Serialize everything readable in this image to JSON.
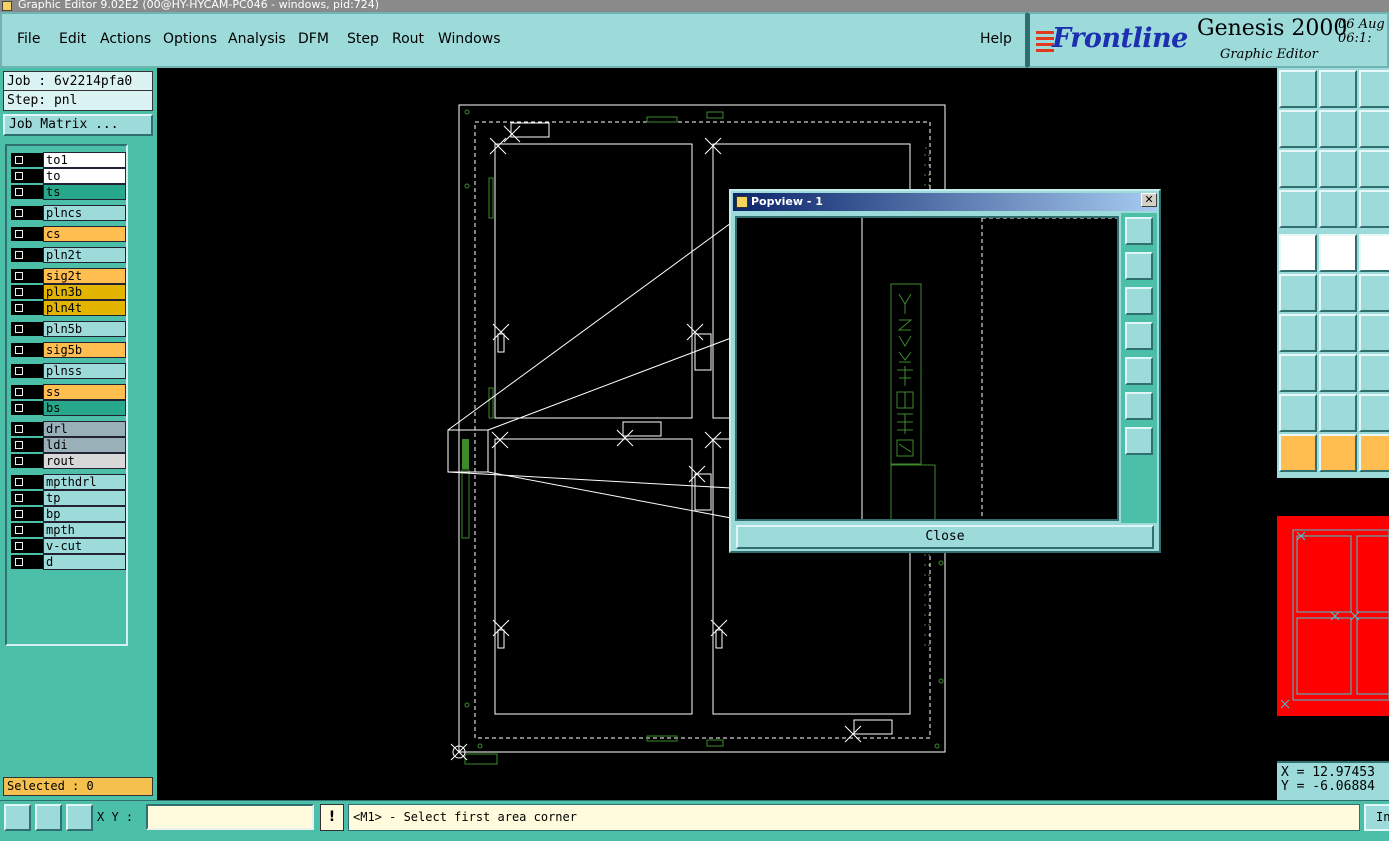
{
  "window": {
    "title": "Graphic Editor 9.02E2 (00@HY-HYCAM-PC046 - windows, pid:724)"
  },
  "menu": {
    "items": [
      {
        "label": "File"
      },
      {
        "label": "Edit"
      },
      {
        "label": "Actions"
      },
      {
        "label": "Options"
      },
      {
        "label": "Analysis"
      },
      {
        "label": "DFM"
      },
      {
        "label": "Step"
      },
      {
        "label": "Rout"
      },
      {
        "label": "Windows"
      }
    ],
    "help": "Help"
  },
  "logo": {
    "brand": "Frontline",
    "product": "Genesis 2000",
    "subtitle": "Graphic Editor",
    "date_line1": "06 Aug",
    "date_line2": "06:1:"
  },
  "job": {
    "job_line": "Job : 6v2214pfa0",
    "step_line": "Step: pnl",
    "matrix_button": "Job Matrix ..."
  },
  "layers": [
    {
      "name": "to1",
      "color": "white"
    },
    {
      "name": "to",
      "color": "white"
    },
    {
      "name": "ts",
      "color": "teal"
    },
    {
      "name": "plncs",
      "color": "cyan"
    },
    {
      "name": "cs",
      "color": "orange"
    },
    {
      "name": "pln2t",
      "color": "cyan"
    },
    {
      "name": "sig2t",
      "color": "orange"
    },
    {
      "name": "pln3b",
      "color": "gold"
    },
    {
      "name": "pln4t",
      "color": "gold"
    },
    {
      "name": "pln5b",
      "color": "cyan"
    },
    {
      "name": "sig5b",
      "color": "orange"
    },
    {
      "name": "plnss",
      "color": "cyan"
    },
    {
      "name": "ss",
      "color": "orange"
    },
    {
      "name": "bs",
      "color": "teal"
    },
    {
      "name": "drl",
      "color": "slate"
    },
    {
      "name": "ldi",
      "color": "slate"
    },
    {
      "name": "rout",
      "color": "grey"
    },
    {
      "name": "mpthdrl",
      "color": "cyan"
    },
    {
      "name": "tp",
      "color": "cyan"
    },
    {
      "name": "bp",
      "color": "cyan"
    },
    {
      "name": "mpth",
      "color": "cyan"
    },
    {
      "name": "v-cut",
      "color": "cyan"
    },
    {
      "name": "d",
      "color": "cyan"
    }
  ],
  "selected": "Selected : 0",
  "popview": {
    "title": "Popview - 1",
    "close_x": "✕",
    "close_button": "Close"
  },
  "coords": {
    "x": "X = 12.97453",
    "y": "Y = -6.06884"
  },
  "bottom": {
    "xy_label": "X Y :",
    "xy_value": "",
    "warn": "!",
    "status": "<M1> - Select first area corner",
    "in_button": "In"
  }
}
